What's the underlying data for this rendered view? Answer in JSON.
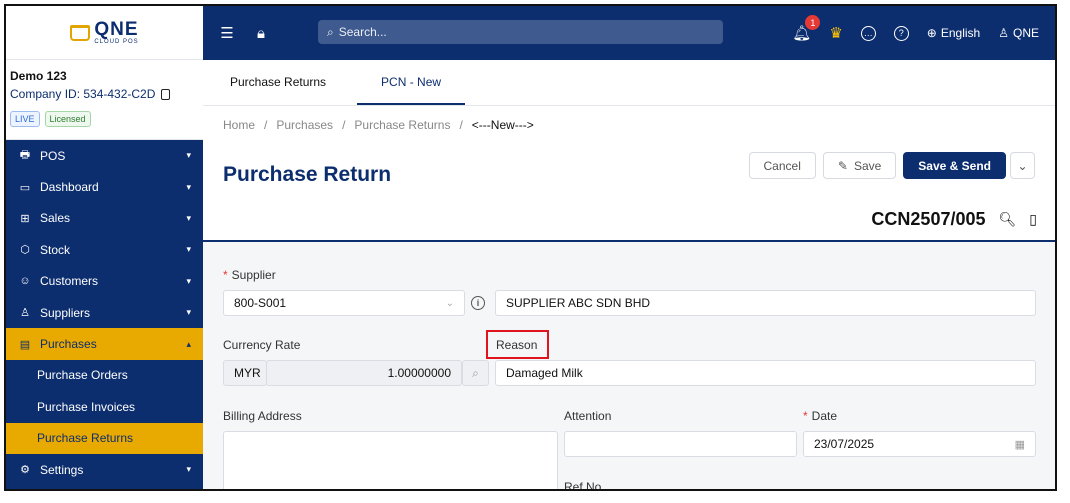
{
  "app": {
    "logo_main": "QNE",
    "logo_sub": "CLOUD POS"
  },
  "company": {
    "name": "Demo 123",
    "id_label": "Company ID: 534-432-C2D",
    "badge_live": "LIVE",
    "badge_licensed": "Licensed"
  },
  "sidebar": {
    "items": [
      {
        "label": "POS",
        "icon": "register-icon"
      },
      {
        "label": "Dashboard",
        "icon": "monitor-icon"
      },
      {
        "label": "Sales",
        "icon": "cart-icon"
      },
      {
        "label": "Stock",
        "icon": "box-icon"
      },
      {
        "label": "Customers",
        "icon": "customers-icon"
      },
      {
        "label": "Suppliers",
        "icon": "user-icon"
      },
      {
        "label": "Purchases",
        "icon": "purchases-icon"
      }
    ],
    "purchases_sub": [
      "Purchase Orders",
      "Purchase Invoices",
      "Purchase Returns"
    ],
    "settings": {
      "label": "Settings",
      "icon": "gear-icon"
    }
  },
  "topbar": {
    "search_placeholder": "Search...",
    "notification_count": "1",
    "language": "English",
    "user": "QNE"
  },
  "tabs": [
    "Purchase Returns",
    "PCN - New"
  ],
  "breadcrumb": [
    "Home",
    "Purchases",
    "Purchase Returns",
    "<---New--->"
  ],
  "page": {
    "title": "Purchase Return",
    "doc_no": "CCN2507/005",
    "cancel_label": "Cancel",
    "save_label": "Save",
    "save_send_label": "Save & Send"
  },
  "form": {
    "supplier_label": "Supplier",
    "supplier_code": "800-S001",
    "supplier_name": "SUPPLIER ABC SDN BHD",
    "currency_rate_label": "Currency Rate",
    "currency": "MYR",
    "rate": "1.00000000",
    "reason_label": "Reason",
    "reason_value": "Damaged Milk",
    "billing_address_label": "Billing Address",
    "attention_label": "Attention",
    "date_label": "Date",
    "date_value": "23/07/2025",
    "ref_no_label": "Ref No."
  },
  "colors": {
    "brand_navy": "#0d2e6e",
    "accent_gold": "#e8a900",
    "highlight_red": "#e0141e"
  }
}
